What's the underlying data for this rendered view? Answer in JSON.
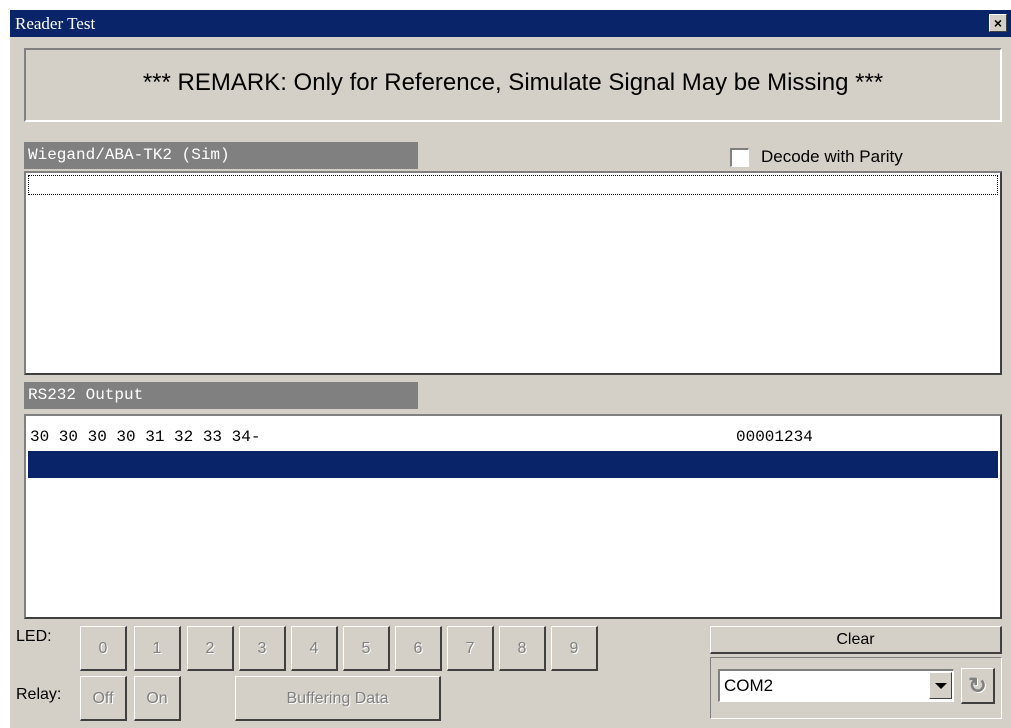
{
  "window": {
    "title": "Reader Test",
    "close_glyph": "×"
  },
  "remark": {
    "text": "*** REMARK: Only for Reference, Simulate Signal May be Missing ***"
  },
  "wiegand": {
    "label": "Wiegand/ABA-TK2 (Sim)",
    "decode_parity_label": "Decode with Parity",
    "decode_parity_checked": false,
    "rows": []
  },
  "rs232": {
    "label": "RS232 Output",
    "rows": [
      {
        "hex": "30 30 30 30 31 32 33 34-",
        "value": "00001234"
      }
    ]
  },
  "led": {
    "label": "LED:",
    "buttons": [
      "0",
      "1",
      "2",
      "3",
      "4",
      "5",
      "6",
      "7",
      "8",
      "9"
    ]
  },
  "relay": {
    "label": "Relay:",
    "off_label": "Off",
    "on_label": "On",
    "buffering_label": "Buffering Data"
  },
  "controls": {
    "clear_label": "Clear",
    "port_value": "COM2",
    "refresh_icon": "refresh-icon"
  },
  "colors": {
    "title_bar": "#0a246a",
    "face": "#d4d0c8",
    "selection": "#0a246a",
    "section_label_bg": "#808080"
  }
}
